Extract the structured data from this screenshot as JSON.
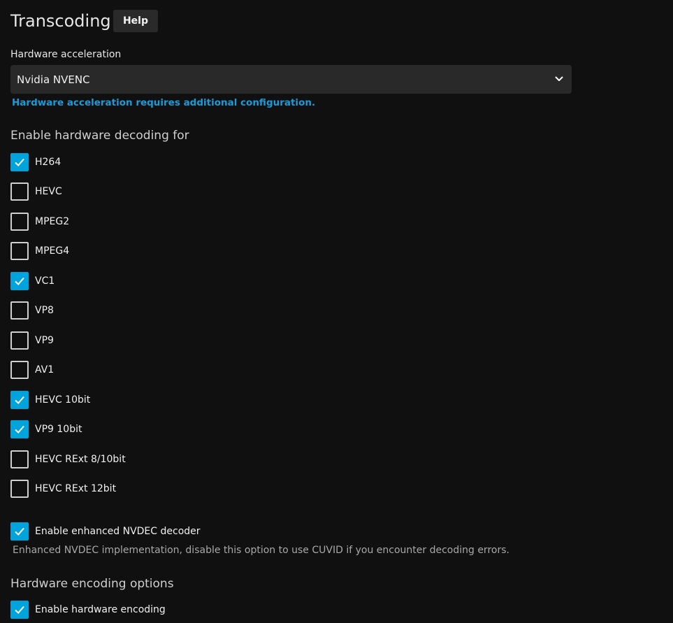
{
  "header": {
    "title": "Transcoding",
    "help_label": "Help"
  },
  "hw_accel": {
    "label": "Hardware acceleration",
    "selected": "Nvidia NVENC",
    "config_link": "Hardware acceleration requires additional configuration."
  },
  "decoding": {
    "heading": "Enable hardware decoding for",
    "items": [
      {
        "label": "H264",
        "checked": true
      },
      {
        "label": "HEVC",
        "checked": false
      },
      {
        "label": "MPEG2",
        "checked": false
      },
      {
        "label": "MPEG4",
        "checked": false
      },
      {
        "label": "VC1",
        "checked": true
      },
      {
        "label": "VP8",
        "checked": false
      },
      {
        "label": "VP9",
        "checked": false
      },
      {
        "label": "AV1",
        "checked": false
      },
      {
        "label": "HEVC 10bit",
        "checked": true
      },
      {
        "label": "VP9 10bit",
        "checked": true
      },
      {
        "label": "HEVC RExt 8/10bit",
        "checked": false
      },
      {
        "label": "HEVC RExt 12bit",
        "checked": false
      }
    ]
  },
  "nvdec": {
    "label": "Enable enhanced NVDEC decoder",
    "checked": true,
    "description": "Enhanced NVDEC implementation, disable this option to use CUVID if you encounter decoding errors."
  },
  "encoding": {
    "heading": "Hardware encoding options",
    "enable_label": "Enable hardware encoding",
    "enable_checked": true
  },
  "colors": {
    "background": "#101010",
    "accent": "#00a4dc",
    "link": "#1a9bd7",
    "select_bg": "#292929"
  }
}
